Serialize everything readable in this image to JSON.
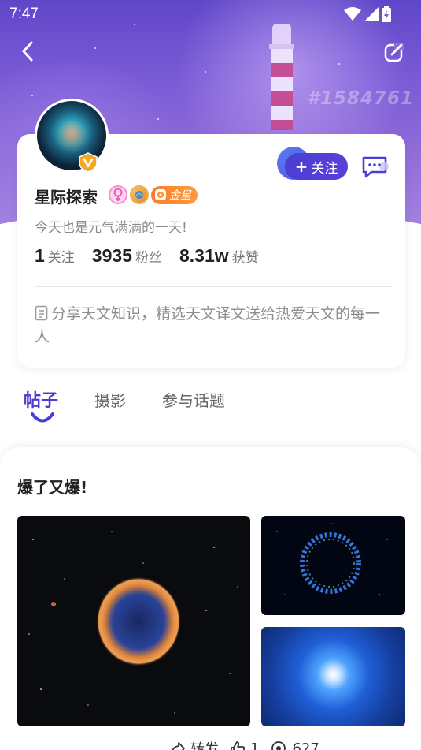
{
  "status_bar": {
    "time": "7:47"
  },
  "header": {
    "background_tag": "#1584761"
  },
  "profile": {
    "name": "星际探索",
    "level_badge": "金星",
    "signature": "今天也是元气满满的一天!",
    "follow_label": "关注",
    "stats": [
      {
        "value": "1",
        "label": "关注"
      },
      {
        "value": "3935",
        "label": "粉丝"
      },
      {
        "value": "8.31w",
        "label": "获赞"
      }
    ],
    "bio": "分享天文知识，精选天文译文送给热爱天文的每一人"
  },
  "tabs": [
    {
      "label": "帖子",
      "active": true
    },
    {
      "label": "摄影",
      "active": false
    },
    {
      "label": "参与话题",
      "active": false
    }
  ],
  "post": {
    "title": "爆了又爆!",
    "share_label": "转发",
    "like_count": "1",
    "view_count": "627"
  },
  "colors": {
    "accent": "#4a3fd2",
    "gold_badge": "#ff8a30",
    "header_purple": "#7a5bd6"
  },
  "icons": {
    "back": "chevron-left-icon",
    "edit": "edit-icon",
    "message": "message-icon",
    "gender": "female-icon",
    "bio_note": "note-icon"
  }
}
